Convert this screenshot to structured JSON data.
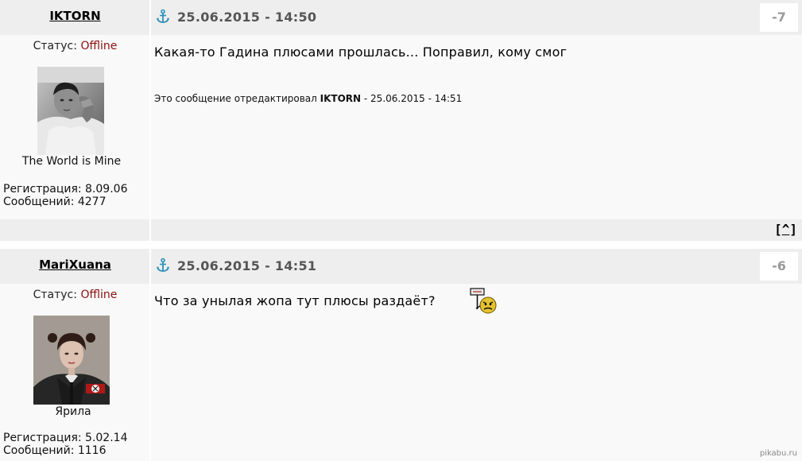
{
  "posts": [
    {
      "username": "IKTORN",
      "date": "25.06.2015 - 14:50",
      "rating": "-7",
      "status_label": "Статус:",
      "status_value": "Offline",
      "user_title": "The World is Mine",
      "registration": "Регистрация: 8.09.06",
      "messages": "Сообщений: 4277",
      "text": "Какая-то Гадина плюсами прошлась... Поправил, кому смог",
      "edit_prefix": "Это сообщение отредактировал",
      "edit_user": "IKTORN",
      "edit_suffix": "- 25.06.2015 - 14:51",
      "back_to_top": "^"
    },
    {
      "username": "MariXuana",
      "date": "25.06.2015 - 14:51",
      "rating": "-6",
      "status_label": "Статус:",
      "status_value": "Offline",
      "user_title": "Ярила",
      "registration": "Регистрация: 5.02.14",
      "messages": "Сообщений: 1116",
      "text": "Что за унылая жопа тут плюсы раздаёт?"
    }
  ],
  "watermark": "pikabu.ru",
  "icons": {
    "anchor": "anchor-icon",
    "smiley": "evil-smiley-sign-icon"
  },
  "colors": {
    "offline": "#8b1010",
    "header_bg": "#eeeeee",
    "body_bg": "#f9f9f9",
    "date": "#555555",
    "rating": "#9a9a9a"
  }
}
